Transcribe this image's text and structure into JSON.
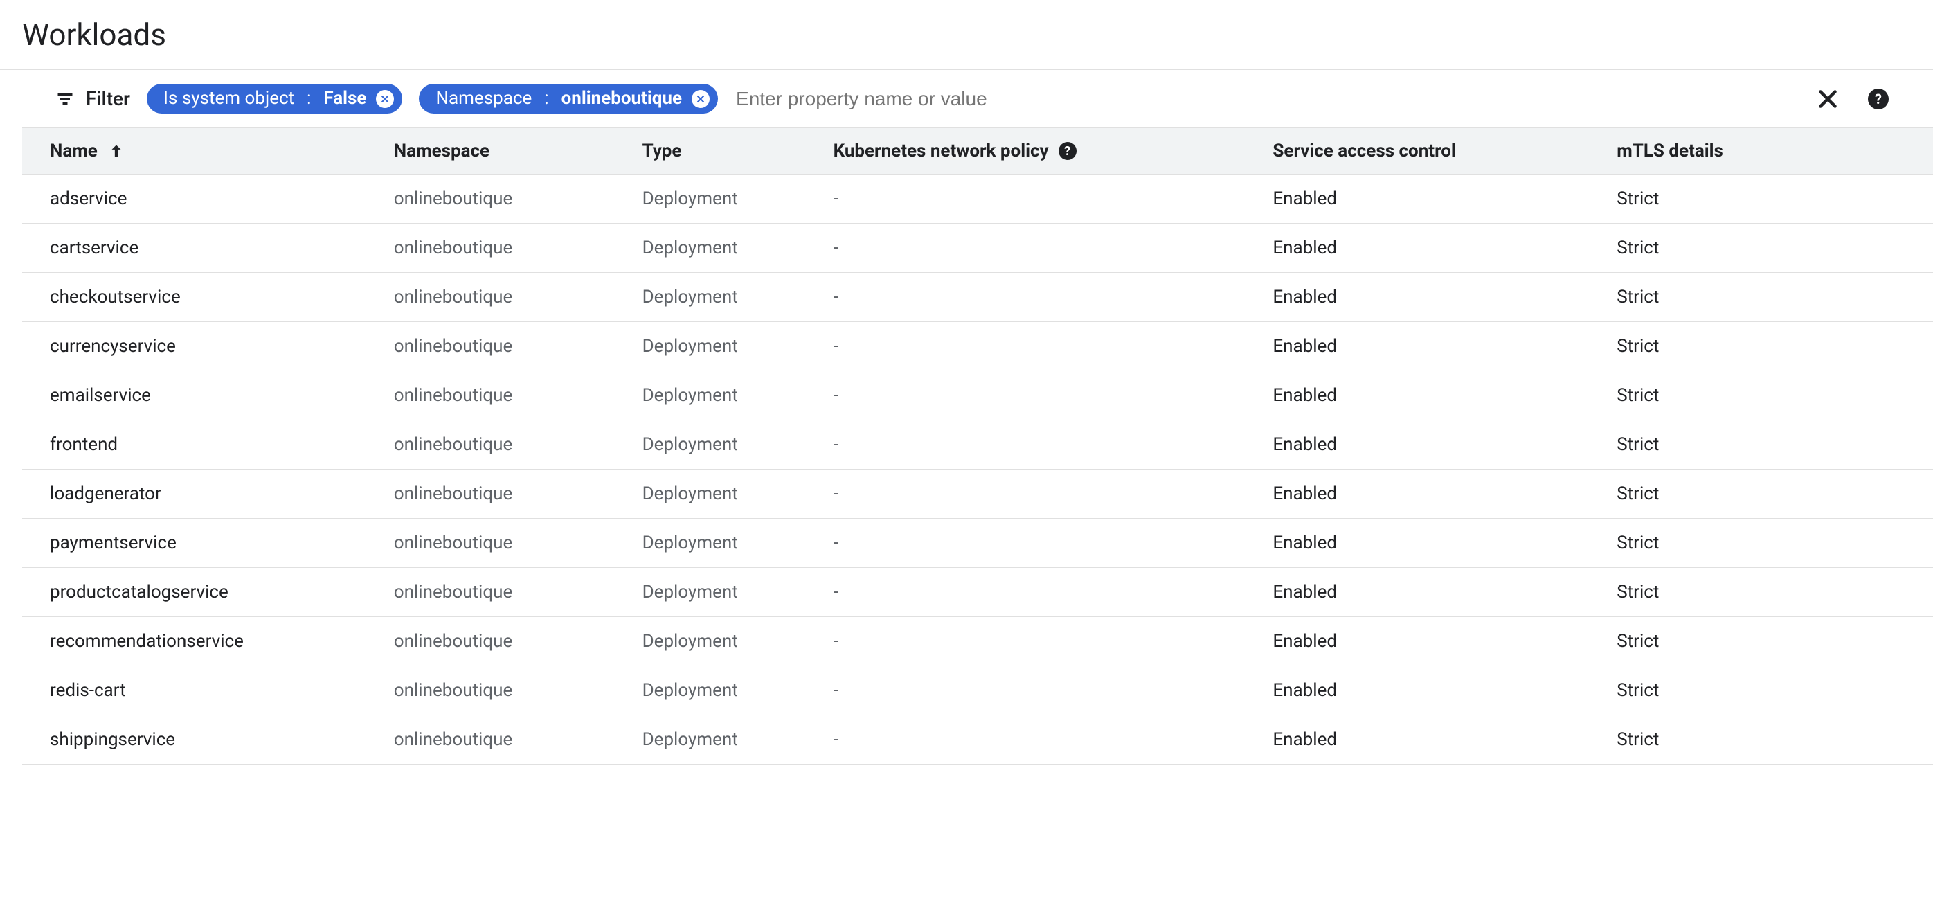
{
  "title": "Workloads",
  "filter": {
    "label": "Filter",
    "chips": [
      {
        "key": "Is system object",
        "value": "False"
      },
      {
        "key": "Namespace",
        "value": "onlineboutique"
      }
    ],
    "placeholder": "Enter property name or value"
  },
  "columns": {
    "name": "Name",
    "namespace": "Namespace",
    "type": "Type",
    "knp": "Kubernetes network policy",
    "sac": "Service access control",
    "mtls": "mTLS details"
  },
  "rows": [
    {
      "name": "adservice",
      "namespace": "onlineboutique",
      "type": "Deployment",
      "knp": "-",
      "sac": "Enabled",
      "mtls": "Strict"
    },
    {
      "name": "cartservice",
      "namespace": "onlineboutique",
      "type": "Deployment",
      "knp": "-",
      "sac": "Enabled",
      "mtls": "Strict"
    },
    {
      "name": "checkoutservice",
      "namespace": "onlineboutique",
      "type": "Deployment",
      "knp": "-",
      "sac": "Enabled",
      "mtls": "Strict"
    },
    {
      "name": "currencyservice",
      "namespace": "onlineboutique",
      "type": "Deployment",
      "knp": "-",
      "sac": "Enabled",
      "mtls": "Strict"
    },
    {
      "name": "emailservice",
      "namespace": "onlineboutique",
      "type": "Deployment",
      "knp": "-",
      "sac": "Enabled",
      "mtls": "Strict"
    },
    {
      "name": "frontend",
      "namespace": "onlineboutique",
      "type": "Deployment",
      "knp": "-",
      "sac": "Enabled",
      "mtls": "Strict"
    },
    {
      "name": "loadgenerator",
      "namespace": "onlineboutique",
      "type": "Deployment",
      "knp": "-",
      "sac": "Enabled",
      "mtls": "Strict"
    },
    {
      "name": "paymentservice",
      "namespace": "onlineboutique",
      "type": "Deployment",
      "knp": "-",
      "sac": "Enabled",
      "mtls": "Strict"
    },
    {
      "name": "productcatalogservice",
      "namespace": "onlineboutique",
      "type": "Deployment",
      "knp": "-",
      "sac": "Enabled",
      "mtls": "Strict"
    },
    {
      "name": "recommendationservice",
      "namespace": "onlineboutique",
      "type": "Deployment",
      "knp": "-",
      "sac": "Enabled",
      "mtls": "Strict"
    },
    {
      "name": "redis-cart",
      "namespace": "onlineboutique",
      "type": "Deployment",
      "knp": "-",
      "sac": "Enabled",
      "mtls": "Strict"
    },
    {
      "name": "shippingservice",
      "namespace": "onlineboutique",
      "type": "Deployment",
      "knp": "-",
      "sac": "Enabled",
      "mtls": "Strict"
    }
  ]
}
